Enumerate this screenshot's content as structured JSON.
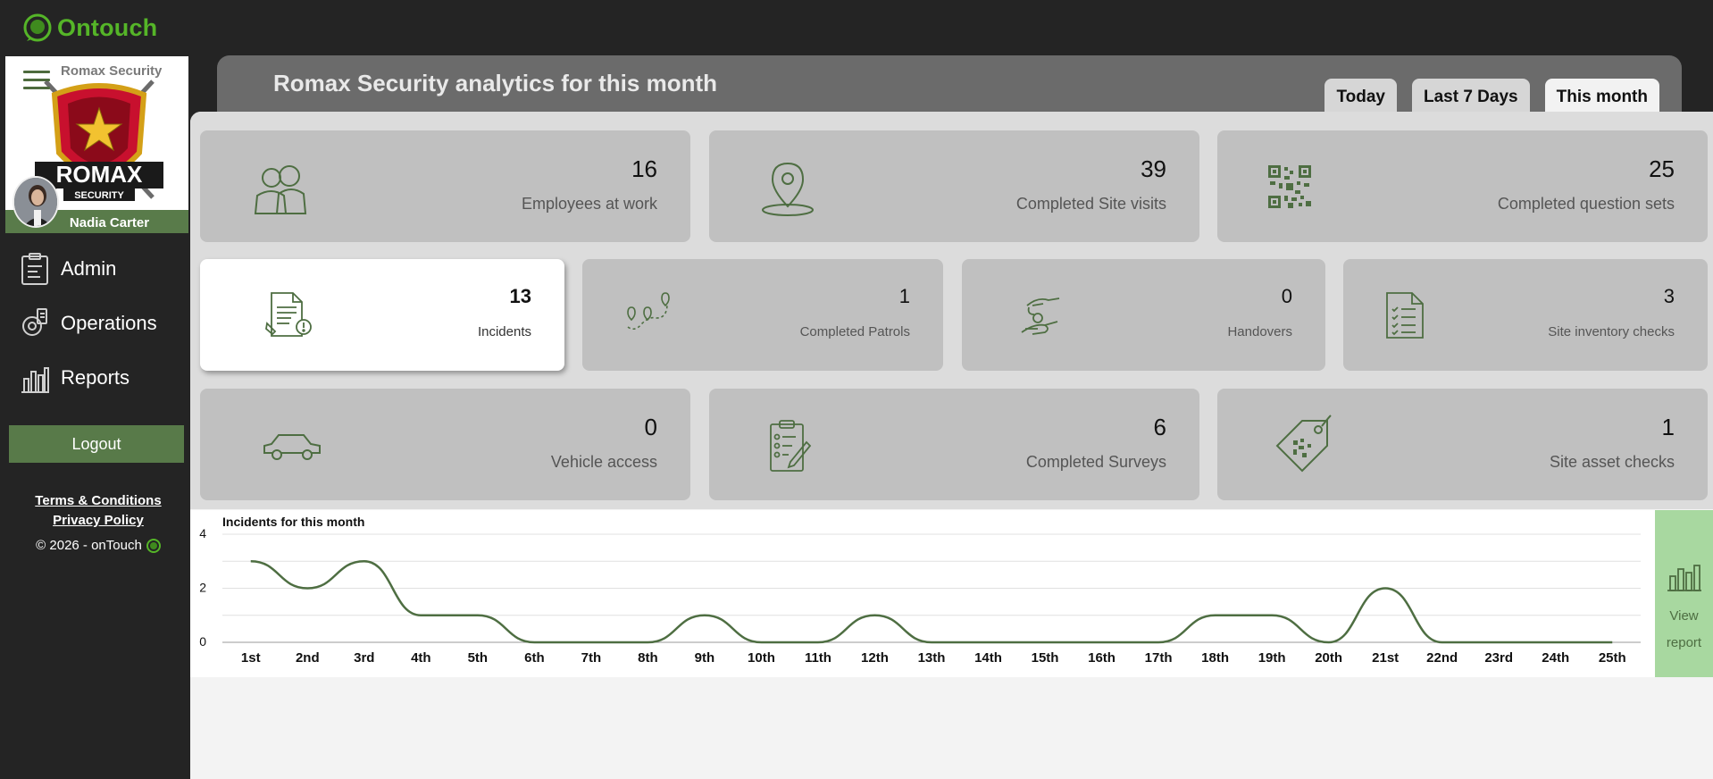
{
  "brand": {
    "name": "Ontouch",
    "color": "#55b528"
  },
  "profile": {
    "company": "Romax Security",
    "crest_text": "ROMAX",
    "crest_subtext": "SECURITY",
    "user_name": "Nadia Carter"
  },
  "nav": [
    {
      "label": "Admin",
      "icon": "clipboard-icon"
    },
    {
      "label": "Operations",
      "icon": "operations-gear-icon"
    },
    {
      "label": "Reports",
      "icon": "bar-chart-icon"
    }
  ],
  "logout_label": "Logout",
  "footer": {
    "terms": "Terms & Conditions",
    "privacy": "Privacy Policy",
    "copyright": "© 2026 - onTouch"
  },
  "header": {
    "title": "Romax Security analytics for this month",
    "tabs": [
      {
        "label": "Today",
        "active": false
      },
      {
        "label": "Last 7 Days",
        "active": false
      },
      {
        "label": "This month",
        "active": true
      }
    ]
  },
  "cards": {
    "employees": {
      "value": "16",
      "label": "Employees at work",
      "icon": "people-icon"
    },
    "site_visits": {
      "value": "39",
      "label": "Completed Site visits",
      "icon": "location-pin-icon"
    },
    "question_sets": {
      "value": "25",
      "label": "Completed question sets",
      "icon": "qr-code-icon"
    },
    "incidents": {
      "value": "13",
      "label": "Incidents",
      "icon": "incident-report-icon"
    },
    "patrols": {
      "value": "1",
      "label": "Completed Patrols",
      "icon": "patrol-route-icon"
    },
    "handovers": {
      "value": "0",
      "label": "Handovers",
      "icon": "handover-icon"
    },
    "inventory": {
      "value": "3",
      "label": "Site inventory checks",
      "icon": "checklist-icon"
    },
    "vehicle": {
      "value": "0",
      "label": "Vehicle access",
      "icon": "car-icon"
    },
    "surveys": {
      "value": "6",
      "label": "Completed Surveys",
      "icon": "survey-clipboard-icon"
    },
    "asset_checks": {
      "value": "1",
      "label": "Site asset checks",
      "icon": "asset-tag-icon"
    }
  },
  "chart_data": {
    "type": "line",
    "title": "Incidents for this month",
    "xlabel": "",
    "ylabel": "",
    "ylim": [
      0,
      4
    ],
    "yticks": [
      "0",
      "2",
      "4"
    ],
    "grid": true,
    "smooth": true,
    "line_color": "#4e6e42",
    "categories": [
      "1st",
      "2nd",
      "3rd",
      "4th",
      "5th",
      "6th",
      "7th",
      "8th",
      "9th",
      "10th",
      "11th",
      "12th",
      "13th",
      "14th",
      "15th",
      "16th",
      "17th",
      "18th",
      "19th",
      "20th",
      "21st",
      "22nd",
      "23rd",
      "24th",
      "25th"
    ],
    "values": [
      3,
      2,
      3,
      1,
      1,
      0,
      0,
      0,
      1,
      0,
      0,
      1,
      0,
      0,
      0,
      0,
      0,
      1,
      1,
      0,
      2,
      0,
      0,
      0,
      0
    ]
  },
  "view_report": {
    "line1": "View",
    "line2": "report",
    "icon": "report-chart-icon"
  }
}
